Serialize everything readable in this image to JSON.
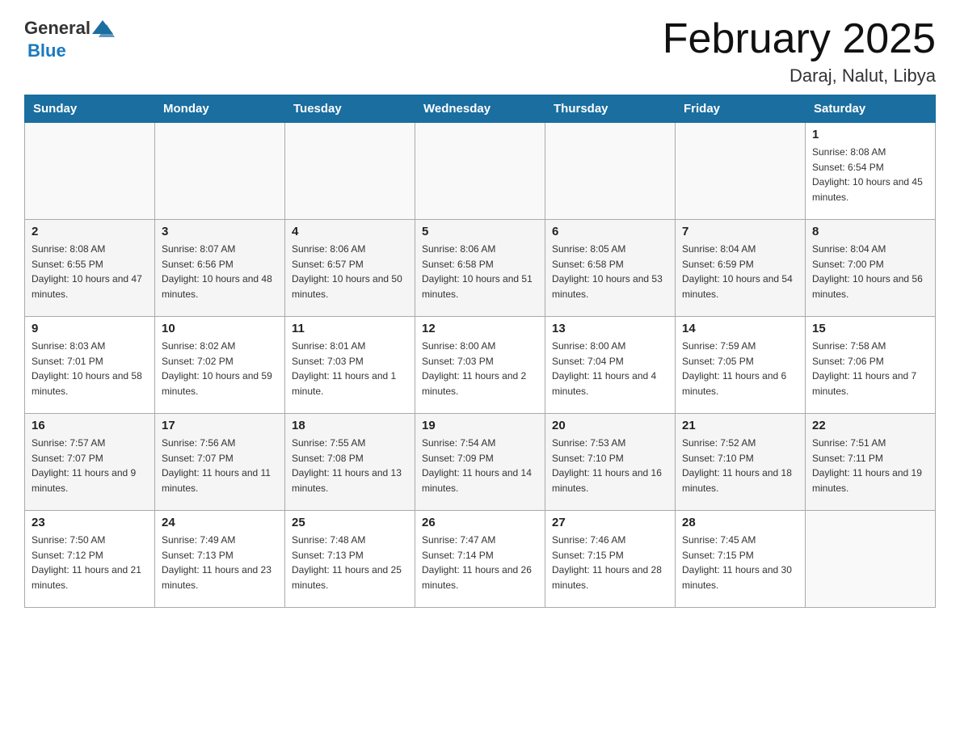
{
  "header": {
    "title": "February 2025",
    "location": "Daraj, Nalut, Libya",
    "logo_general": "General",
    "logo_blue": "Blue"
  },
  "days_of_week": [
    "Sunday",
    "Monday",
    "Tuesday",
    "Wednesday",
    "Thursday",
    "Friday",
    "Saturday"
  ],
  "weeks": [
    [
      {
        "day": "",
        "sunrise": "",
        "sunset": "",
        "daylight": "",
        "empty": true
      },
      {
        "day": "",
        "sunrise": "",
        "sunset": "",
        "daylight": "",
        "empty": true
      },
      {
        "day": "",
        "sunrise": "",
        "sunset": "",
        "daylight": "",
        "empty": true
      },
      {
        "day": "",
        "sunrise": "",
        "sunset": "",
        "daylight": "",
        "empty": true
      },
      {
        "day": "",
        "sunrise": "",
        "sunset": "",
        "daylight": "",
        "empty": true
      },
      {
        "day": "",
        "sunrise": "",
        "sunset": "",
        "daylight": "",
        "empty": true
      },
      {
        "day": "1",
        "sunrise": "Sunrise: 8:08 AM",
        "sunset": "Sunset: 6:54 PM",
        "daylight": "Daylight: 10 hours and 45 minutes.",
        "empty": false
      }
    ],
    [
      {
        "day": "2",
        "sunrise": "Sunrise: 8:08 AM",
        "sunset": "Sunset: 6:55 PM",
        "daylight": "Daylight: 10 hours and 47 minutes.",
        "empty": false
      },
      {
        "day": "3",
        "sunrise": "Sunrise: 8:07 AM",
        "sunset": "Sunset: 6:56 PM",
        "daylight": "Daylight: 10 hours and 48 minutes.",
        "empty": false
      },
      {
        "day": "4",
        "sunrise": "Sunrise: 8:06 AM",
        "sunset": "Sunset: 6:57 PM",
        "daylight": "Daylight: 10 hours and 50 minutes.",
        "empty": false
      },
      {
        "day": "5",
        "sunrise": "Sunrise: 8:06 AM",
        "sunset": "Sunset: 6:58 PM",
        "daylight": "Daylight: 10 hours and 51 minutes.",
        "empty": false
      },
      {
        "day": "6",
        "sunrise": "Sunrise: 8:05 AM",
        "sunset": "Sunset: 6:58 PM",
        "daylight": "Daylight: 10 hours and 53 minutes.",
        "empty": false
      },
      {
        "day": "7",
        "sunrise": "Sunrise: 8:04 AM",
        "sunset": "Sunset: 6:59 PM",
        "daylight": "Daylight: 10 hours and 54 minutes.",
        "empty": false
      },
      {
        "day": "8",
        "sunrise": "Sunrise: 8:04 AM",
        "sunset": "Sunset: 7:00 PM",
        "daylight": "Daylight: 10 hours and 56 minutes.",
        "empty": false
      }
    ],
    [
      {
        "day": "9",
        "sunrise": "Sunrise: 8:03 AM",
        "sunset": "Sunset: 7:01 PM",
        "daylight": "Daylight: 10 hours and 58 minutes.",
        "empty": false
      },
      {
        "day": "10",
        "sunrise": "Sunrise: 8:02 AM",
        "sunset": "Sunset: 7:02 PM",
        "daylight": "Daylight: 10 hours and 59 minutes.",
        "empty": false
      },
      {
        "day": "11",
        "sunrise": "Sunrise: 8:01 AM",
        "sunset": "Sunset: 7:03 PM",
        "daylight": "Daylight: 11 hours and 1 minute.",
        "empty": false
      },
      {
        "day": "12",
        "sunrise": "Sunrise: 8:00 AM",
        "sunset": "Sunset: 7:03 PM",
        "daylight": "Daylight: 11 hours and 2 minutes.",
        "empty": false
      },
      {
        "day": "13",
        "sunrise": "Sunrise: 8:00 AM",
        "sunset": "Sunset: 7:04 PM",
        "daylight": "Daylight: 11 hours and 4 minutes.",
        "empty": false
      },
      {
        "day": "14",
        "sunrise": "Sunrise: 7:59 AM",
        "sunset": "Sunset: 7:05 PM",
        "daylight": "Daylight: 11 hours and 6 minutes.",
        "empty": false
      },
      {
        "day": "15",
        "sunrise": "Sunrise: 7:58 AM",
        "sunset": "Sunset: 7:06 PM",
        "daylight": "Daylight: 11 hours and 7 minutes.",
        "empty": false
      }
    ],
    [
      {
        "day": "16",
        "sunrise": "Sunrise: 7:57 AM",
        "sunset": "Sunset: 7:07 PM",
        "daylight": "Daylight: 11 hours and 9 minutes.",
        "empty": false
      },
      {
        "day": "17",
        "sunrise": "Sunrise: 7:56 AM",
        "sunset": "Sunset: 7:07 PM",
        "daylight": "Daylight: 11 hours and 11 minutes.",
        "empty": false
      },
      {
        "day": "18",
        "sunrise": "Sunrise: 7:55 AM",
        "sunset": "Sunset: 7:08 PM",
        "daylight": "Daylight: 11 hours and 13 minutes.",
        "empty": false
      },
      {
        "day": "19",
        "sunrise": "Sunrise: 7:54 AM",
        "sunset": "Sunset: 7:09 PM",
        "daylight": "Daylight: 11 hours and 14 minutes.",
        "empty": false
      },
      {
        "day": "20",
        "sunrise": "Sunrise: 7:53 AM",
        "sunset": "Sunset: 7:10 PM",
        "daylight": "Daylight: 11 hours and 16 minutes.",
        "empty": false
      },
      {
        "day": "21",
        "sunrise": "Sunrise: 7:52 AM",
        "sunset": "Sunset: 7:10 PM",
        "daylight": "Daylight: 11 hours and 18 minutes.",
        "empty": false
      },
      {
        "day": "22",
        "sunrise": "Sunrise: 7:51 AM",
        "sunset": "Sunset: 7:11 PM",
        "daylight": "Daylight: 11 hours and 19 minutes.",
        "empty": false
      }
    ],
    [
      {
        "day": "23",
        "sunrise": "Sunrise: 7:50 AM",
        "sunset": "Sunset: 7:12 PM",
        "daylight": "Daylight: 11 hours and 21 minutes.",
        "empty": false
      },
      {
        "day": "24",
        "sunrise": "Sunrise: 7:49 AM",
        "sunset": "Sunset: 7:13 PM",
        "daylight": "Daylight: 11 hours and 23 minutes.",
        "empty": false
      },
      {
        "day": "25",
        "sunrise": "Sunrise: 7:48 AM",
        "sunset": "Sunset: 7:13 PM",
        "daylight": "Daylight: 11 hours and 25 minutes.",
        "empty": false
      },
      {
        "day": "26",
        "sunrise": "Sunrise: 7:47 AM",
        "sunset": "Sunset: 7:14 PM",
        "daylight": "Daylight: 11 hours and 26 minutes.",
        "empty": false
      },
      {
        "day": "27",
        "sunrise": "Sunrise: 7:46 AM",
        "sunset": "Sunset: 7:15 PM",
        "daylight": "Daylight: 11 hours and 28 minutes.",
        "empty": false
      },
      {
        "day": "28",
        "sunrise": "Sunrise: 7:45 AM",
        "sunset": "Sunset: 7:15 PM",
        "daylight": "Daylight: 11 hours and 30 minutes.",
        "empty": false
      },
      {
        "day": "",
        "sunrise": "",
        "sunset": "",
        "daylight": "",
        "empty": true
      }
    ]
  ]
}
